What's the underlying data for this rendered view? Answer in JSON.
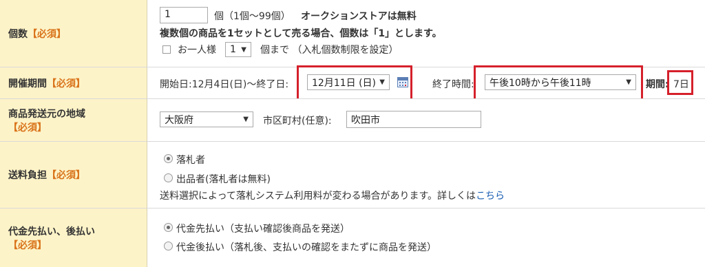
{
  "quantity": {
    "label": "個数",
    "required": "【必須】",
    "value": "1",
    "unit_note": "個（1個〜99個）",
    "free_note": "オークションストアは無料",
    "set_note": "複数個の商品を1セットとして売る場合、個数は「1」とします。",
    "limit_checkbox_label": "お一人様",
    "limit_value": "1",
    "limit_suffix": "個まで （入札個数制限を設定）"
  },
  "period": {
    "label": "開催期間",
    "required": "【必須】",
    "start_text": "開始日:12月4日(日)〜終了日:",
    "end_date": "12月11日 (日)",
    "end_time_label": "終了時間:",
    "end_time": "午後10時から午後11時",
    "duration_label": "期間:",
    "duration": "7日"
  },
  "region": {
    "label": "商品発送元の地域",
    "required": "【必須】",
    "prefecture": "大阪府",
    "city_label": "市区町村(任意):",
    "city_value": "吹田市"
  },
  "shipping": {
    "label": "送料負担",
    "required": "【必須】",
    "option_winner": "落札者",
    "option_seller": "出品者(落札者は無料)",
    "note": "送料選択によって落札システム利用料が変わる場合があります。詳しくは",
    "note_link": "こちら"
  },
  "payment": {
    "label": "代金先払い、後払い",
    "required": "【必須】",
    "option_prepay": "代金先払い（支払い確認後商品を発送）",
    "option_postpay": "代金後払い（落札後、支払いの確認をまたずに商品を発送）"
  },
  "colors": {
    "label_bg": "#fdf3c8",
    "required": "#d9731a",
    "highlight": "#d5202b",
    "link": "#1a5fb4"
  }
}
